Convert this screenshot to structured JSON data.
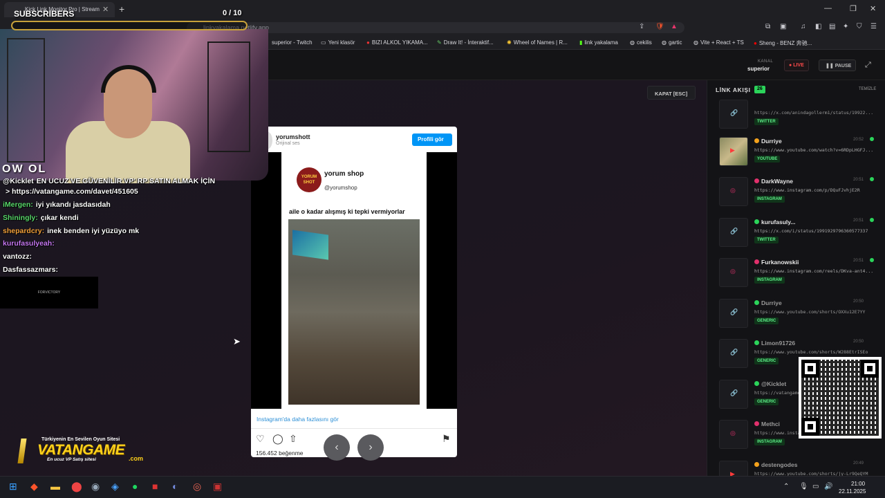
{
  "browser": {
    "tab_title": "Kick Link Monitor Pro | Stream",
    "url": "linkyakalama.netlify.app",
    "bookmarks": [
      {
        "icon": "twitch-icon",
        "label": "superior - Twitch"
      },
      {
        "icon": "folder-icon",
        "label": "Yeni klasör"
      },
      {
        "icon": "site-icon",
        "label": "BIZI ALKOL YIKAMA..."
      },
      {
        "icon": "brush-icon",
        "label": "Draw It! - İnteraktif..."
      },
      {
        "icon": "wheel-icon",
        "label": "Wheel of Names | R..."
      },
      {
        "icon": "kick-icon",
        "label": "link yakalama"
      },
      {
        "icon": "globe-icon",
        "label": "cekilis"
      },
      {
        "icon": "globe-icon",
        "label": "gartic"
      },
      {
        "icon": "globe-icon",
        "label": "Vite + React + TS"
      },
      {
        "icon": "youtube-icon",
        "label": "Sheng - BENZ 奔驰..."
      }
    ]
  },
  "header": {
    "kanal_label": "KANAL",
    "kanal_value": "superior",
    "live_label": "LIVE",
    "pause_label": "PAUSE"
  },
  "main": {
    "close_label": "KAPAT [ESC]"
  },
  "embed": {
    "username": "yorumshott",
    "subtitle": "Orijinal ses",
    "profile_button": "Profili gör",
    "shot_logo": "YORUM SHOT",
    "shot_name": "yorum shop",
    "shot_handle": "@yorumshop",
    "caption": "aile o kadar alışmış ki tepki vermiyorlar",
    "more_link": "Instagram'da daha fazlasını gör",
    "likes": "156.452 beğenme"
  },
  "sidebar": {
    "title": "LİNK AKIŞI",
    "count": "26",
    "clear_label": "TEMİZLE",
    "items": [
      {
        "user": "",
        "time": "",
        "url": "https://x.com/anindagollerm1/status/19922...",
        "badge": "TWITTER",
        "platform": "twitter",
        "live": false
      },
      {
        "user": "Durriye",
        "time": "20:52",
        "url": "https://www.youtube.com/watch?v=6RDpLHGFJ...",
        "badge": "YOUTUBE",
        "platform": "youtube",
        "live": true
      },
      {
        "user": "DarkWayne",
        "time": "20:51",
        "url": "https://www.instagram.com/p/DQuFJvhjE2R",
        "badge": "INSTAGRAM",
        "platform": "instagram",
        "live": true
      },
      {
        "user": "kurufasuly...",
        "time": "20:51",
        "url": "https://x.com/i/status/1991929796360577337",
        "badge": "TWITTER",
        "platform": "twitter",
        "live": true
      },
      {
        "user": "Furkanowskii",
        "time": "20:51",
        "url": "https://www.instagram.com/reels/DKva-ant4...",
        "badge": "INSTAGRAM",
        "platform": "instagram",
        "live": true
      },
      {
        "user": "Durriye",
        "time": "20:50",
        "url": "https://www.youtube.com/shorts/OXXu12E7YY",
        "badge": "GENERIC",
        "platform": "generic",
        "live": false
      },
      {
        "user": "Limon91726",
        "time": "20:50",
        "url": "https://www.youtube.com/shorts/W288EtrISEo",
        "badge": "GENERIC",
        "platform": "generic",
        "live": false
      },
      {
        "user": "@Kicklet",
        "time": "",
        "url": "https://vatangame.com/davet/451605",
        "badge": "GENERIC",
        "platform": "generic",
        "live": false
      },
      {
        "user": "Methci",
        "time": "",
        "url": "https://www.instagram.com/...",
        "badge": "INSTAGRAM",
        "platform": "instagram",
        "live": false
      },
      {
        "user": "destengodes",
        "time": "20:49",
        "url": "https://www.youtube.com/shorts/jy-Lr9QeQYM",
        "badge": "",
        "platform": "youtube",
        "live": false
      }
    ]
  },
  "overlay": {
    "subscribers_label": "SUBSCRIBERS",
    "subscribers_count": "0 / 10",
    "owl_text": "OW OL",
    "forvictory": "FORVICTORY",
    "chat": [
      {
        "user": "@Kicklet",
        "message": "EN UCUZ VE GÜVENİLİR VP' RP SATIN ALMAK İÇİN",
        "color": "#ffffff"
      },
      {
        "user": "",
        "message": "> https://vatangame.com/davet/451605",
        "color": "#ffffff"
      },
      {
        "user": "iMergen:",
        "message": "iyi yıkandı jasdasıdah",
        "color": "#59d86b"
      },
      {
        "user": "Shiningly:",
        "message": "çıkar kendi",
        "color": "#59d86b"
      },
      {
        "user": "shepardcry:",
        "message": "inek benden iyi yüzüyo mk",
        "color": "#f2a13c"
      },
      {
        "user": "kurufasulyeah:",
        "message": "",
        "color": "#c678f2"
      },
      {
        "user": "vantozz:",
        "message": "",
        "color": "#ffffff"
      },
      {
        "user": "Dasfassazmars:",
        "message": "",
        "color": "#ffffff"
      }
    ],
    "vatangame_tagline": "Türkiyenin En Sevilen Oyun Sitesi",
    "vatangame_logo": "VATANGAME",
    "vatangame_com": ".com",
    "vatangame_sub": "En ucuz VP Satış sitesi"
  },
  "taskbar": {
    "time": "21:00",
    "date": "22.11.2025",
    "apps": [
      "windows-icon",
      "brave-icon",
      "files-icon",
      "maps-icon",
      "steam-icon",
      "app-icon",
      "spotify-icon",
      "app-icon",
      "discord-icon",
      "app-icon",
      "app-icon"
    ]
  },
  "colors": {
    "accent_green": "#2bd45a",
    "live_red": "#ff4a4a",
    "instagram_blue": "#0095f6"
  }
}
